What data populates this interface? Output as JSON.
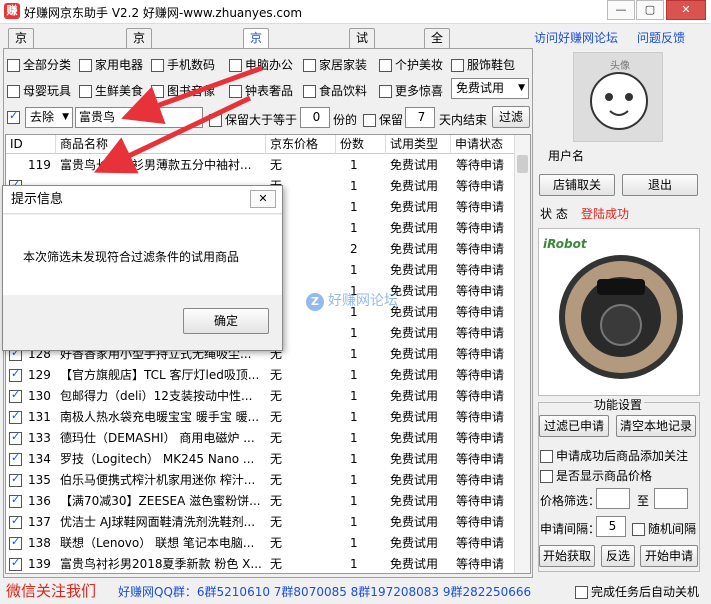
{
  "window": {
    "title": "好赚网京东助手 V2.2 好赚网-www.zhuanyes.com",
    "min": "—",
    "max": "▢",
    "close": "✕"
  },
  "tabs": [
    "京东关注领京豆",
    "京东签到领京豆",
    "京东试用申请",
    "试用报告",
    "全网线报"
  ],
  "links": {
    "forum": "访问好赚网论坛",
    "feedback": "问题反馈"
  },
  "categories": [
    {
      "label": "全部分类",
      "checked": false
    },
    {
      "label": "家用电器",
      "checked": false
    },
    {
      "label": "手机数码",
      "checked": false
    },
    {
      "label": "电脑办公",
      "checked": false
    },
    {
      "label": "家居家装",
      "checked": false
    },
    {
      "label": "个护美妆",
      "checked": false
    },
    {
      "label": "服饰鞋包",
      "checked": false
    },
    {
      "label": "母婴玩具",
      "checked": false
    },
    {
      "label": "生鲜美食",
      "checked": false
    },
    {
      "label": "图书音像",
      "checked": false
    },
    {
      "label": "钟表奢品",
      "checked": false
    },
    {
      "label": "食品饮料",
      "checked": false
    },
    {
      "label": "更多惊喜",
      "checked": false
    }
  ],
  "type_select": "免费试用",
  "filter": {
    "checked": true,
    "mode": "去除",
    "keyword": "富贵鸟",
    "keep_gt_label": "保留大于等于",
    "keep_gt_value": "0",
    "unit_fen": "份的",
    "keep_label": "保留",
    "keep_days_value": "7",
    "days_end_label": "天内结束",
    "filter_button": "过滤"
  },
  "table": {
    "headers": [
      "ID",
      "商品名称",
      "京东价格",
      "份数",
      "试用类型",
      "申请状态"
    ],
    "rows": [
      {
        "checked": null,
        "id": "119",
        "name": "富贵鸟长袖衬衫男薄款五分中袖衬...",
        "price": "无",
        "qty": "1",
        "type": "免费试用",
        "status": "等待申请"
      },
      {
        "checked": true,
        "id": "",
        "name": "",
        "price": "无",
        "qty": "1",
        "type": "免费试用",
        "status": "等待申请"
      },
      {
        "checked": true,
        "id": "",
        "name": "",
        "price": "无",
        "qty": "1",
        "type": "免费试用",
        "status": "等待申请"
      },
      {
        "checked": true,
        "id": "",
        "name": "",
        "price": "无",
        "qty": "1",
        "type": "免费试用",
        "status": "等待申请"
      },
      {
        "checked": true,
        "id": "",
        "name": "",
        "price": "无",
        "qty": "2",
        "type": "免费试用",
        "status": "等待申请"
      },
      {
        "checked": true,
        "id": "",
        "name": "",
        "price": "无",
        "qty": "1",
        "type": "免费试用",
        "status": "等待申请"
      },
      {
        "checked": true,
        "id": "",
        "name": "",
        "price": "无",
        "qty": "1",
        "type": "免费试用",
        "status": "等待申请"
      },
      {
        "checked": true,
        "id": "",
        "name": "",
        "price": "无",
        "qty": "1",
        "type": "免费试用",
        "status": "等待申请"
      },
      {
        "checked": true,
        "id": "",
        "name": "",
        "price": "无",
        "qty": "1",
        "type": "免费试用",
        "status": "等待申请"
      },
      {
        "checked": true,
        "id": "128",
        "name": "好香香家用小型手持立式无绳吸尘...",
        "price": "无",
        "qty": "1",
        "type": "免费试用",
        "status": "等待申请"
      },
      {
        "checked": true,
        "id": "129",
        "name": "【官方旗舰店】TCL 客厅灯led吸顶...",
        "price": "无",
        "qty": "1",
        "type": "免费试用",
        "status": "等待申请"
      },
      {
        "checked": true,
        "id": "130",
        "name": "包邮得力（deli）12支装按动中性...",
        "price": "无",
        "qty": "1",
        "type": "免费试用",
        "status": "等待申请"
      },
      {
        "checked": true,
        "id": "131",
        "name": "南极人热水袋充电暖宝宝 暖手宝 暖...",
        "price": "无",
        "qty": "1",
        "type": "免费试用",
        "status": "等待申请"
      },
      {
        "checked": true,
        "id": "133",
        "name": "德玛仕（DEMASHI） 商用电磁炉 ...",
        "price": "无",
        "qty": "1",
        "type": "免费试用",
        "status": "等待申请"
      },
      {
        "checked": true,
        "id": "134",
        "name": "罗技（Logitech） MK245 Nano ...",
        "price": "无",
        "qty": "1",
        "type": "免费试用",
        "status": "等待申请"
      },
      {
        "checked": true,
        "id": "135",
        "name": "伯乐马便携式榨汁机家用迷你 榨汁...",
        "price": "无",
        "qty": "1",
        "type": "免费试用",
        "status": "等待申请"
      },
      {
        "checked": true,
        "id": "136",
        "name": "【满70减30】ZEESEA 滋色蜜粉饼...",
        "price": "无",
        "qty": "1",
        "type": "免费试用",
        "status": "等待申请"
      },
      {
        "checked": true,
        "id": "137",
        "name": "优洁士 AJ球鞋网面鞋清洗剂洗鞋剂...",
        "price": "无",
        "qty": "1",
        "type": "免费试用",
        "status": "等待申请"
      },
      {
        "checked": true,
        "id": "138",
        "name": "联想（Lenovo） 联想 笔记本电脑...",
        "price": "无",
        "qty": "1",
        "type": "免费试用",
        "status": "等待申请"
      },
      {
        "checked": true,
        "id": "139",
        "name": "富贵鸟衬衫男2018夏季新款 粉色 X...",
        "price": "无",
        "qty": "1",
        "type": "免费试用",
        "status": "等待申请"
      }
    ]
  },
  "dialog": {
    "title": "提示信息",
    "message": "本次筛选未发现符合过滤条件的试用商品",
    "ok": "确定",
    "close": "✕"
  },
  "watermark": {
    "icon": "Z",
    "text": "好赚网论坛"
  },
  "right": {
    "avatar_text": "头像",
    "username_label": "用户名",
    "shop_follow": "店铺取关",
    "logout": "退出",
    "status_label": "状  态",
    "status_value": "登陆成功",
    "product_brand": "iRobot",
    "func_title": "功能设置",
    "filter_applied": "过滤已申请",
    "clear_local": "清空本地记录",
    "opt_follow": "申请成功后商品添加关注",
    "opt_price": "是否显示商品价格",
    "price_filter_label": "价格筛选：",
    "price_to": "至",
    "price_min": "",
    "price_max": "",
    "interval_label": "申请间隔：",
    "interval_value": "5",
    "random_interval": "随机间隔",
    "start_fetch": "开始获取",
    "invert": "反选",
    "start_apply": "开始申请"
  },
  "bottom": {
    "wechat": "微信关注我们",
    "qq_groups": "好赚网QQ群：6群5210610  7群8070085  8群197208083  9群282250666",
    "auto_shutdown": "完成任务后自动关机"
  },
  "colors": {
    "accent_blue": "#1a4fd6",
    "red": "#e3231b",
    "arrow_red": "#e8323a"
  }
}
